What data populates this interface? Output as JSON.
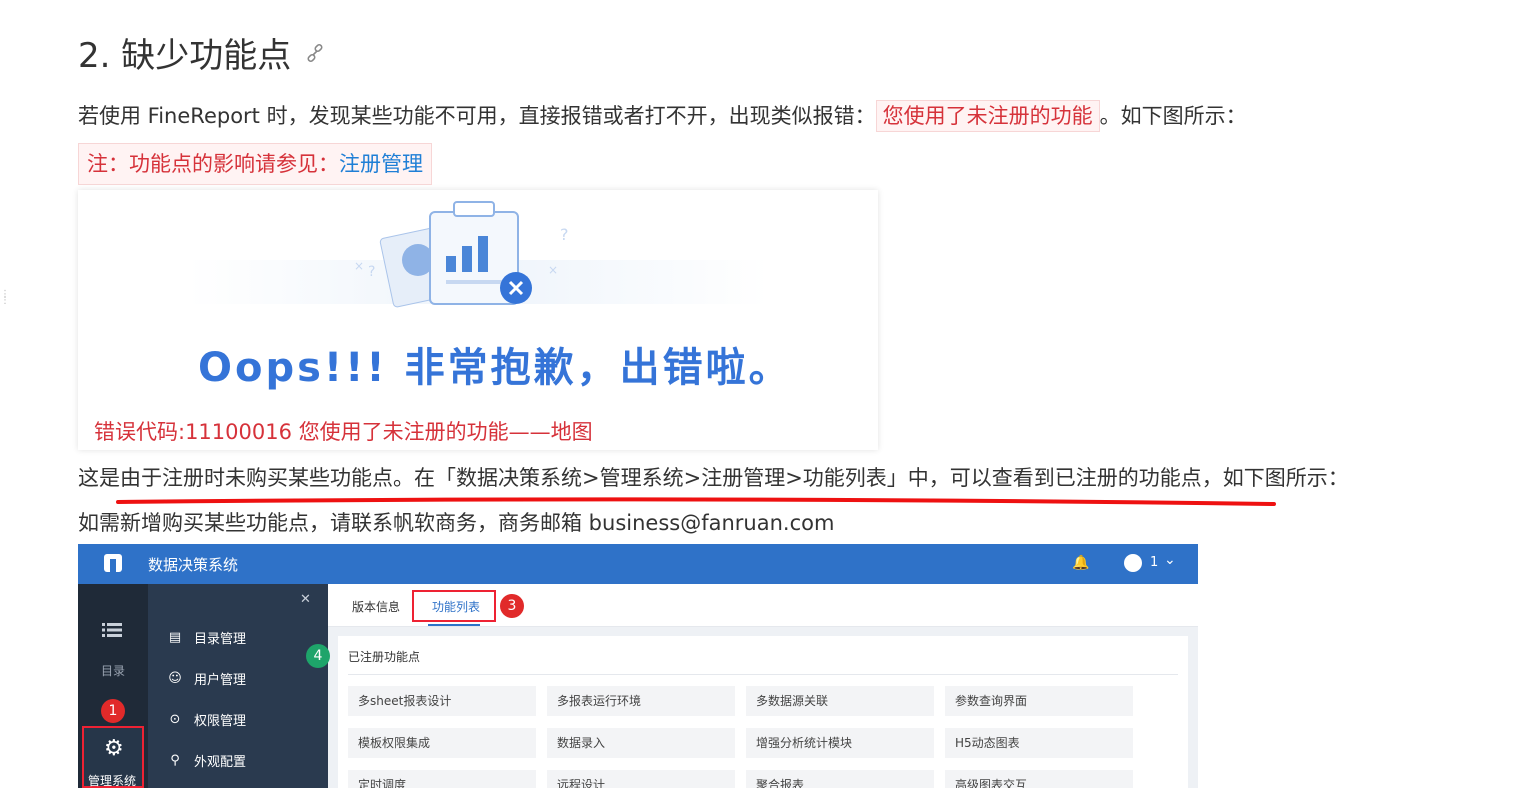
{
  "heading": {
    "text": "2. 缺少功能点",
    "icon": "link-icon"
  },
  "para1": {
    "before": "若使用 FineReport 时，发现某些功能不可用，直接报错或者打不开，出现类似报错：",
    "highlight": "您使用了未注册的功能",
    "after": "。如下图所示："
  },
  "note": {
    "prefix": "注：功能点的影响请参见：",
    "link": "注册管理"
  },
  "error_image": {
    "message": "Oops!!! 非常抱歉，出错啦。",
    "code": "错误代码:11100016 您使用了未注册的功能——地图"
  },
  "para2": {
    "text": "这是由于注册时未购买某些功能点。在「数据决策系统>管理系统>注册管理>功能列表」中，可以查看到已注册的功能点，如下图所示："
  },
  "para3": {
    "text": "如需新增购买某些功能点，请联系帆软商务，商务邮箱 business@fanruan.com"
  },
  "system": {
    "title": "数据决策系统",
    "user": "1",
    "rail": {
      "catalog": "目录",
      "admin": "管理系统"
    },
    "menu": [
      "目录管理",
      "用户管理",
      "权限管理",
      "外观配置"
    ],
    "tabs": {
      "version": "版本信息",
      "features": "功能列表"
    },
    "panel_title": "已注册功能点",
    "features": [
      "多sheet报表设计",
      "多报表运行环境",
      "多数据源关联",
      "参数查询界面",
      "模板权限集成",
      "数据录入",
      "增强分析统计模块",
      "H5动态图表",
      "定时调度",
      "远程设计",
      "聚合报表",
      "高级图表交互"
    ],
    "badges": [
      "1",
      "3",
      "4"
    ]
  },
  "colors": {
    "accent_red": "#d6323a",
    "link_blue": "#1f7fd6",
    "topbar_blue": "#2f72c8"
  }
}
